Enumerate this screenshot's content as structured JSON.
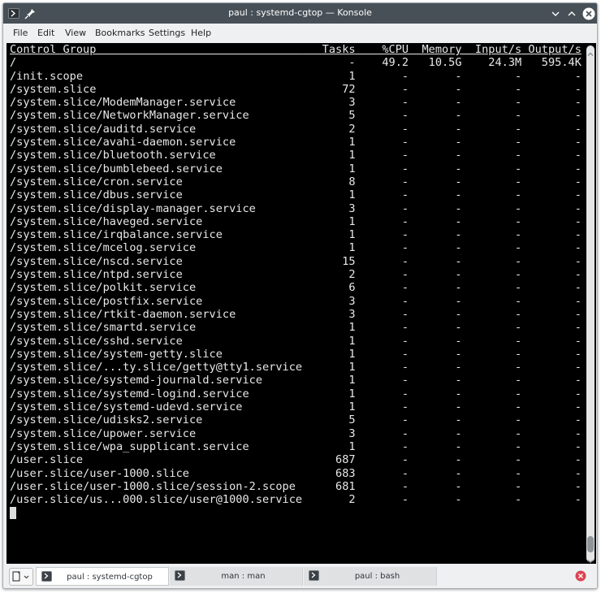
{
  "window": {
    "title": "paul : systemd-cgtop — Konsole",
    "app_icon": "konsole-icon",
    "pin_icon": "pin-icon",
    "controls": [
      "minimize-icon",
      "maximize-icon",
      "close-icon"
    ]
  },
  "menubar": {
    "items": [
      "File",
      "Edit",
      "View",
      "Bookmarks",
      "Settings",
      "Help"
    ]
  },
  "terminal": {
    "header": {
      "control_group": "Control Group",
      "tasks": "Tasks",
      "cpu": "%CPU",
      "memory": "Memory",
      "input": "Input/s",
      "output": "Output/s"
    },
    "rows": [
      {
        "path": "/",
        "tasks": "-",
        "cpu": "49.2",
        "memory": "10.5G",
        "input": "24.3M",
        "output": "595.4K"
      },
      {
        "path": "/init.scope",
        "tasks": "1",
        "cpu": "-",
        "memory": "-",
        "input": "-",
        "output": "-"
      },
      {
        "path": "/system.slice",
        "tasks": "72",
        "cpu": "-",
        "memory": "-",
        "input": "-",
        "output": "-"
      },
      {
        "path": "/system.slice/ModemManager.service",
        "tasks": "3",
        "cpu": "-",
        "memory": "-",
        "input": "-",
        "output": "-"
      },
      {
        "path": "/system.slice/NetworkManager.service",
        "tasks": "5",
        "cpu": "-",
        "memory": "-",
        "input": "-",
        "output": "-"
      },
      {
        "path": "/system.slice/auditd.service",
        "tasks": "2",
        "cpu": "-",
        "memory": "-",
        "input": "-",
        "output": "-"
      },
      {
        "path": "/system.slice/avahi-daemon.service",
        "tasks": "1",
        "cpu": "-",
        "memory": "-",
        "input": "-",
        "output": "-"
      },
      {
        "path": "/system.slice/bluetooth.service",
        "tasks": "1",
        "cpu": "-",
        "memory": "-",
        "input": "-",
        "output": "-"
      },
      {
        "path": "/system.slice/bumblebeed.service",
        "tasks": "1",
        "cpu": "-",
        "memory": "-",
        "input": "-",
        "output": "-"
      },
      {
        "path": "/system.slice/cron.service",
        "tasks": "8",
        "cpu": "-",
        "memory": "-",
        "input": "-",
        "output": "-"
      },
      {
        "path": "/system.slice/dbus.service",
        "tasks": "1",
        "cpu": "-",
        "memory": "-",
        "input": "-",
        "output": "-"
      },
      {
        "path": "/system.slice/display-manager.service",
        "tasks": "3",
        "cpu": "-",
        "memory": "-",
        "input": "-",
        "output": "-"
      },
      {
        "path": "/system.slice/haveged.service",
        "tasks": "1",
        "cpu": "-",
        "memory": "-",
        "input": "-",
        "output": "-"
      },
      {
        "path": "/system.slice/irqbalance.service",
        "tasks": "1",
        "cpu": "-",
        "memory": "-",
        "input": "-",
        "output": "-"
      },
      {
        "path": "/system.slice/mcelog.service",
        "tasks": "1",
        "cpu": "-",
        "memory": "-",
        "input": "-",
        "output": "-"
      },
      {
        "path": "/system.slice/nscd.service",
        "tasks": "15",
        "cpu": "-",
        "memory": "-",
        "input": "-",
        "output": "-"
      },
      {
        "path": "/system.slice/ntpd.service",
        "tasks": "2",
        "cpu": "-",
        "memory": "-",
        "input": "-",
        "output": "-"
      },
      {
        "path": "/system.slice/polkit.service",
        "tasks": "6",
        "cpu": "-",
        "memory": "-",
        "input": "-",
        "output": "-"
      },
      {
        "path": "/system.slice/postfix.service",
        "tasks": "3",
        "cpu": "-",
        "memory": "-",
        "input": "-",
        "output": "-"
      },
      {
        "path": "/system.slice/rtkit-daemon.service",
        "tasks": "3",
        "cpu": "-",
        "memory": "-",
        "input": "-",
        "output": "-"
      },
      {
        "path": "/system.slice/smartd.service",
        "tasks": "1",
        "cpu": "-",
        "memory": "-",
        "input": "-",
        "output": "-"
      },
      {
        "path": "/system.slice/sshd.service",
        "tasks": "1",
        "cpu": "-",
        "memory": "-",
        "input": "-",
        "output": "-"
      },
      {
        "path": "/system.slice/system-getty.slice",
        "tasks": "1",
        "cpu": "-",
        "memory": "-",
        "input": "-",
        "output": "-"
      },
      {
        "path": "/system.slice/...ty.slice/getty@tty1.service",
        "tasks": "1",
        "cpu": "-",
        "memory": "-",
        "input": "-",
        "output": "-"
      },
      {
        "path": "/system.slice/systemd-journald.service",
        "tasks": "1",
        "cpu": "-",
        "memory": "-",
        "input": "-",
        "output": "-"
      },
      {
        "path": "/system.slice/systemd-logind.service",
        "tasks": "1",
        "cpu": "-",
        "memory": "-",
        "input": "-",
        "output": "-"
      },
      {
        "path": "/system.slice/systemd-udevd.service",
        "tasks": "1",
        "cpu": "-",
        "memory": "-",
        "input": "-",
        "output": "-"
      },
      {
        "path": "/system.slice/udisks2.service",
        "tasks": "5",
        "cpu": "-",
        "memory": "-",
        "input": "-",
        "output": "-"
      },
      {
        "path": "/system.slice/upower.service",
        "tasks": "3",
        "cpu": "-",
        "memory": "-",
        "input": "-",
        "output": "-"
      },
      {
        "path": "/system.slice/wpa_supplicant.service",
        "tasks": "1",
        "cpu": "-",
        "memory": "-",
        "input": "-",
        "output": "-"
      },
      {
        "path": "/user.slice",
        "tasks": "687",
        "cpu": "-",
        "memory": "-",
        "input": "-",
        "output": "-"
      },
      {
        "path": "/user.slice/user-1000.slice",
        "tasks": "683",
        "cpu": "-",
        "memory": "-",
        "input": "-",
        "output": "-"
      },
      {
        "path": "/user.slice/user-1000.slice/session-2.scope",
        "tasks": "681",
        "cpu": "-",
        "memory": "-",
        "input": "-",
        "output": "-"
      },
      {
        "path": "/user.slice/us...000.slice/user@1000.service",
        "tasks": "2",
        "cpu": "-",
        "memory": "-",
        "input": "-",
        "output": "-"
      }
    ]
  },
  "tabs": [
    {
      "label": "paul : systemd-cgtop",
      "active": true
    },
    {
      "label": "man : man",
      "active": false
    },
    {
      "label": "paul : bash",
      "active": false
    }
  ],
  "tabbar": {
    "new_tab_icon": "new-tab-icon",
    "close_tab_icon": "close-tab-icon"
  },
  "colors": {
    "titlebar": "#475057",
    "terminal_bg": "#000000",
    "terminal_fg": "#e8e8e8",
    "close_red": "#da4453"
  }
}
